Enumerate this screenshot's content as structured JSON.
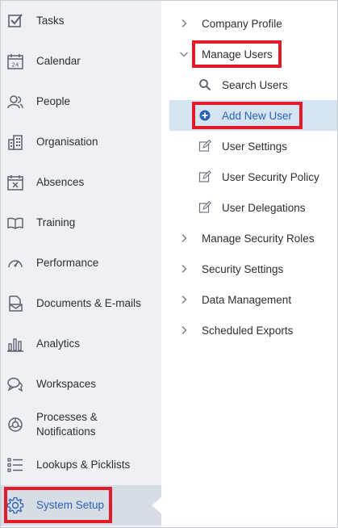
{
  "sidebar": {
    "items": [
      {
        "label": "Tasks",
        "icon": "checkbox-icon"
      },
      {
        "label": "Calendar",
        "icon": "calendar-icon"
      },
      {
        "label": "People",
        "icon": "people-icon"
      },
      {
        "label": "Organisation",
        "icon": "building-icon"
      },
      {
        "label": "Absences",
        "icon": "calendar-x-icon"
      },
      {
        "label": "Training",
        "icon": "book-icon"
      },
      {
        "label": "Performance",
        "icon": "gauge-icon"
      },
      {
        "label": "Documents & E-mails",
        "icon": "document-mail-icon"
      },
      {
        "label": "Analytics",
        "icon": "bar-chart-icon"
      },
      {
        "label": "Workspaces",
        "icon": "chat-bubbles-icon"
      },
      {
        "label": "Processes &",
        "label2": "Notifications",
        "icon": "process-icon"
      },
      {
        "label": "Lookups & Picklists",
        "icon": "list-icon"
      },
      {
        "label": "System Setup",
        "icon": "gear-icon",
        "active": true
      }
    ]
  },
  "menu": {
    "company_profile": "Company Profile",
    "manage_users": "Manage Users",
    "search_users": "Search Users",
    "add_new_user": "Add New User",
    "user_settings": "User Settings",
    "user_security_policy": "User Security Policy",
    "user_delegations": "User Delegations",
    "manage_security_roles": "Manage Security Roles",
    "security_settings": "Security Settings",
    "data_management": "Data Management",
    "scheduled_exports": "Scheduled Exports"
  },
  "colors": {
    "accent": "#2a63b5",
    "highlight_box": "#e21b2a",
    "sidebar_bg": "#eef0f3",
    "selected_bg": "#d6e4f2"
  }
}
